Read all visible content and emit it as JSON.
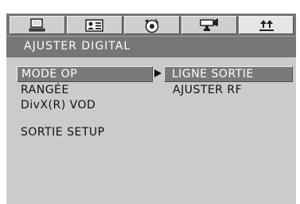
{
  "tabs": [
    {
      "icon": "computer-monitor-icon",
      "active": false
    },
    {
      "icon": "id-card-icon",
      "active": false
    },
    {
      "icon": "speaker-disc-icon",
      "active": false
    },
    {
      "icon": "video-camera-icon",
      "active": false
    },
    {
      "icon": "sliders-arrows-icon",
      "active": true
    }
  ],
  "header": {
    "title": "AJUSTER DIGITAL"
  },
  "left_menu": {
    "items": [
      {
        "label": "MODE OP",
        "selected": true
      },
      {
        "label": "RANGÉE",
        "selected": false
      },
      {
        "label": "DivX(R) VOD",
        "selected": false
      },
      {
        "label": "SORTIE SETUP",
        "selected": false
      }
    ]
  },
  "right_menu": {
    "items": [
      {
        "label": "LIGNE SORTIE",
        "selected": true
      },
      {
        "label": "AJUSTER RF",
        "selected": false
      }
    ]
  },
  "colors": {
    "panel": "#cbcbcb",
    "header": "#767676",
    "highlight": "#7a7a7a",
    "text": "#111111"
  }
}
